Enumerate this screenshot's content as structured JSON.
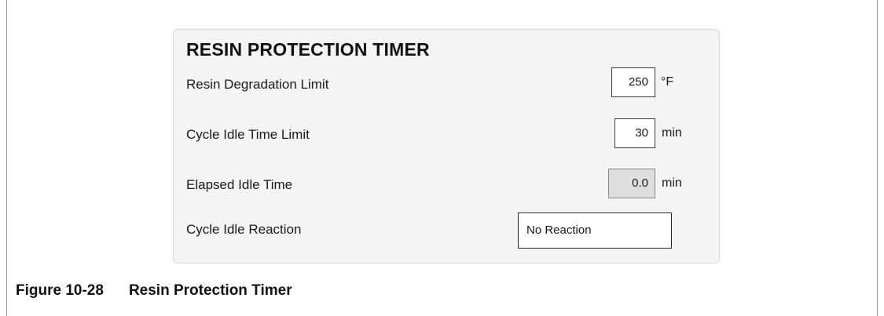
{
  "panel": {
    "title": "RESIN PROTECTION TIMER",
    "rows": [
      {
        "label": "Resin Degradation Limit",
        "value": "250",
        "unit": "°F",
        "editable": true
      },
      {
        "label": "Cycle Idle Time Limit",
        "value": "30",
        "unit": "min",
        "editable": true
      },
      {
        "label": "Elapsed Idle Time",
        "value": "0.0",
        "unit": "min",
        "editable": false
      }
    ],
    "reaction": {
      "label": "Cycle Idle Reaction",
      "value": "No Reaction"
    }
  },
  "caption": {
    "number": "Figure 10-28",
    "title": "Resin Protection Timer"
  }
}
